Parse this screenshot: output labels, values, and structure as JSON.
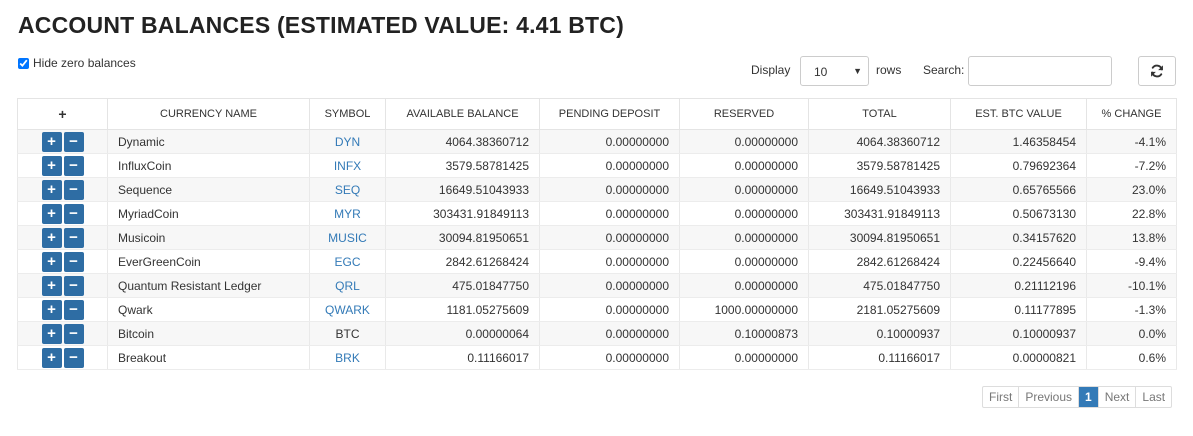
{
  "header": {
    "title": "ACCOUNT BALANCES (ESTIMATED VALUE: 4.41 BTC)"
  },
  "filters": {
    "hide_zero_label": "Hide zero balances",
    "hide_zero_checked": true
  },
  "controls": {
    "display_label": "Display",
    "rows_value": "10",
    "rows_label": "rows",
    "search_label": "Search:",
    "search_value": "",
    "refresh_icon": "refresh-icon"
  },
  "table": {
    "columns": [
      "+",
      "CURRENCY NAME",
      "SYMBOL",
      "AVAILABLE BALANCE",
      "PENDING DEPOSIT",
      "RESERVED",
      "TOTAL",
      "EST. BTC VALUE",
      "% CHANGE"
    ],
    "rows": [
      {
        "name": "Dynamic",
        "symbol": "DYN",
        "available": "4064.38360712",
        "pending": "0.00000000",
        "reserved": "0.00000000",
        "total": "4064.38360712",
        "btc": "1.46358454",
        "change": "-4.1%"
      },
      {
        "name": "InfluxCoin",
        "symbol": "INFX",
        "available": "3579.58781425",
        "pending": "0.00000000",
        "reserved": "0.00000000",
        "total": "3579.58781425",
        "btc": "0.79692364",
        "change": "-7.2%"
      },
      {
        "name": "Sequence",
        "symbol": "SEQ",
        "available": "16649.51043933",
        "pending": "0.00000000",
        "reserved": "0.00000000",
        "total": "16649.51043933",
        "btc": "0.65765566",
        "change": "23.0%"
      },
      {
        "name": "MyriadCoin",
        "symbol": "MYR",
        "available": "303431.91849113",
        "pending": "0.00000000",
        "reserved": "0.00000000",
        "total": "303431.91849113",
        "btc": "0.50673130",
        "change": "22.8%"
      },
      {
        "name": "Musicoin",
        "symbol": "MUSIC",
        "available": "30094.81950651",
        "pending": "0.00000000",
        "reserved": "0.00000000",
        "total": "30094.81950651",
        "btc": "0.34157620",
        "change": "13.8%"
      },
      {
        "name": "EverGreenCoin",
        "symbol": "EGC",
        "available": "2842.61268424",
        "pending": "0.00000000",
        "reserved": "0.00000000",
        "total": "2842.61268424",
        "btc": "0.22456640",
        "change": "-9.4%"
      },
      {
        "name": "Quantum Resistant Ledger",
        "symbol": "QRL",
        "available": "475.01847750",
        "pending": "0.00000000",
        "reserved": "0.00000000",
        "total": "475.01847750",
        "btc": "0.21112196",
        "change": "-10.1%"
      },
      {
        "name": "Qwark",
        "symbol": "QWARK",
        "available": "1181.05275609",
        "pending": "0.00000000",
        "reserved": "1000.00000000",
        "total": "2181.05275609",
        "btc": "0.11177895",
        "change": "-1.3%"
      },
      {
        "name": "Bitcoin",
        "symbol": "BTC",
        "available": "0.00000064",
        "pending": "0.00000000",
        "reserved": "0.10000873",
        "total": "0.10000937",
        "btc": "0.10000937",
        "change": "0.0%"
      },
      {
        "name": "Breakout",
        "symbol": "BRK",
        "available": "0.11166017",
        "pending": "0.00000000",
        "reserved": "0.00000000",
        "total": "0.11166017",
        "btc": "0.00000821",
        "change": "0.6%"
      }
    ],
    "deposit_symbol": "+",
    "withdraw_symbol": "−"
  },
  "pagination": {
    "first": "First",
    "previous": "Previous",
    "current": "1",
    "next": "Next",
    "last": "Last"
  },
  "colors": {
    "action_button": "#2e6da4",
    "link": "#337ab7",
    "active_page": "#337ab7"
  }
}
